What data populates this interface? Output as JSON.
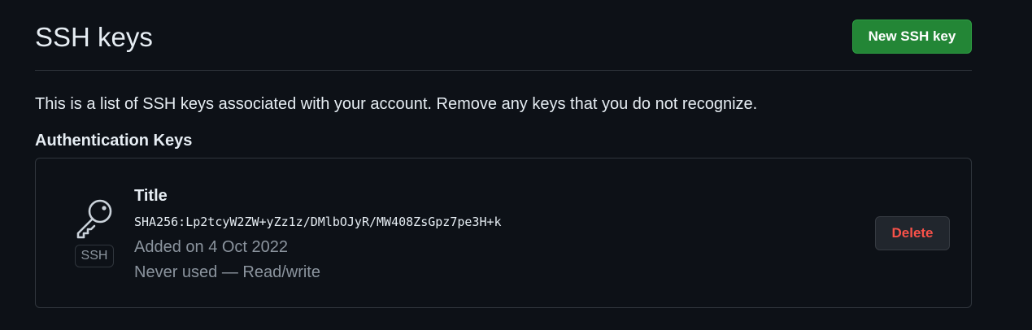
{
  "header": {
    "title": "SSH keys",
    "new_key_label": "New SSH key"
  },
  "description": "This is a list of SSH keys associated with your account. Remove any keys that you do not recognize.",
  "auth_keys": {
    "heading": "Authentication Keys",
    "items": [
      {
        "icon": "key-icon",
        "badge": "SSH",
        "title": "Title",
        "fingerprint": "SHA256:Lp2tcyW2ZW+yZz1z/DMlbOJyR/MW408ZsGpz7pe3H+k",
        "added_on": "Added on 4 Oct 2022",
        "usage": "Never used — Read/write",
        "delete_label": "Delete"
      }
    ]
  },
  "colors": {
    "background": "#0d1117",
    "primary_button": "#238636",
    "danger_text": "#f85149",
    "muted_text": "#8b949e",
    "border": "#30363d"
  }
}
